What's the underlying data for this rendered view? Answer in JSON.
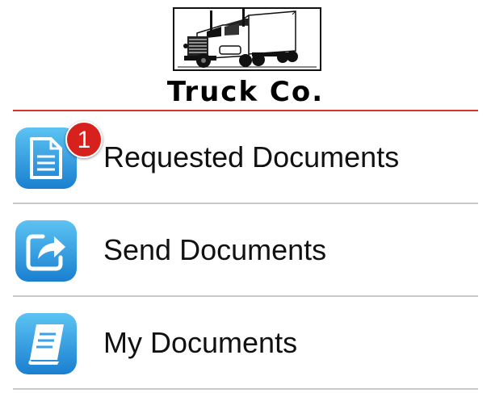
{
  "header": {
    "company_name": "Truck Co.",
    "logo_icon": "truck-logo-icon",
    "rule_color": "#d9322b"
  },
  "menu": {
    "items": [
      {
        "label": "Requested Documents",
        "icon": "document-icon",
        "badge": "1"
      },
      {
        "label": "Send Documents",
        "icon": "share-arrow-icon"
      },
      {
        "label": "My Documents",
        "icon": "book-icon"
      }
    ]
  },
  "colors": {
    "icon_gradient_top": "#5cc3f3",
    "icon_gradient_bottom": "#1a7fd0",
    "badge": "#d6211c",
    "divider": "#c9c9c9"
  }
}
